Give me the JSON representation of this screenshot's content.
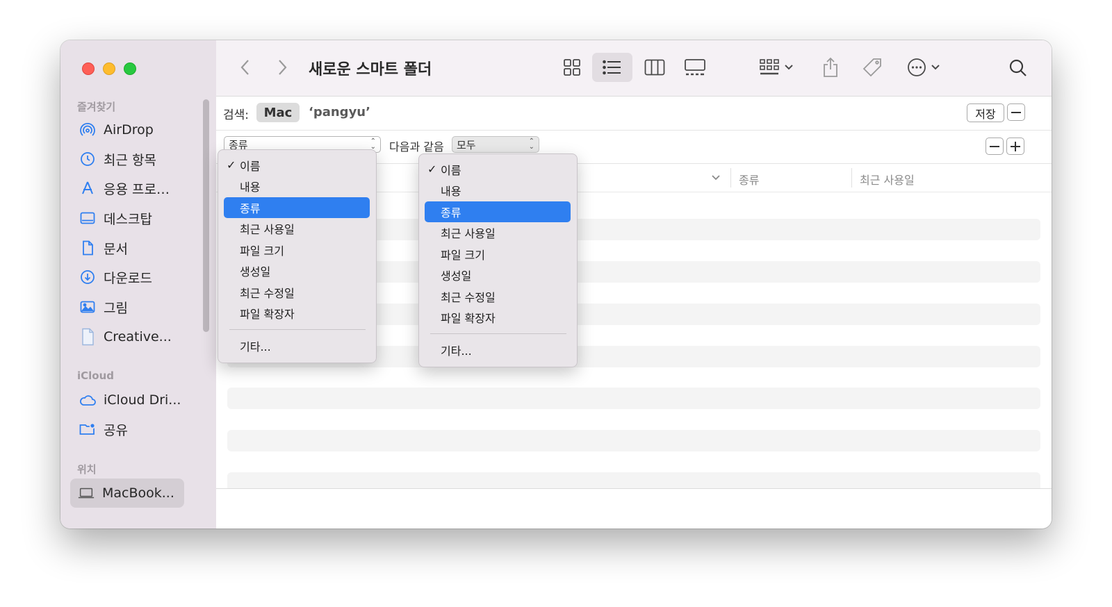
{
  "window": {
    "title": "새로운 스마트 폴더"
  },
  "sidebar": {
    "sections": [
      {
        "label": "즐겨찾기"
      },
      {
        "label": "iCloud"
      },
      {
        "label": "위치"
      }
    ],
    "favorites": [
      {
        "label": "AirDrop",
        "icon": "airdrop-icon"
      },
      {
        "label": "최근 항목",
        "icon": "clock-icon"
      },
      {
        "label": "응용 프로…",
        "icon": "applications-icon"
      },
      {
        "label": "데스크탑",
        "icon": "desktop-icon"
      },
      {
        "label": "문서",
        "icon": "document-icon"
      },
      {
        "label": "다운로드",
        "icon": "download-icon"
      },
      {
        "label": "그림",
        "icon": "pictures-icon"
      },
      {
        "label": "Creative...",
        "icon": "file-icon"
      }
    ],
    "icloud": [
      {
        "label": "iCloud Dri...",
        "icon": "cloud-icon"
      },
      {
        "label": "공유",
        "icon": "shared-folder-icon"
      }
    ],
    "locations": [
      {
        "label": "MacBook...",
        "icon": "laptop-icon",
        "selected": true
      }
    ]
  },
  "search": {
    "label": "검색:",
    "scope": "Mac",
    "term": "‘pangyu’",
    "save_label": "저장"
  },
  "criteria": {
    "attribute": "종류",
    "operator_label": "다음과 같음",
    "value": "모두"
  },
  "columns": [
    {
      "label": "종류"
    },
    {
      "label": "최근 사용일"
    }
  ],
  "menu_left": {
    "checked": "이름",
    "items": [
      "이름",
      "내용",
      "종류",
      "최근 사용일",
      "파일 크기",
      "생성일",
      "최근 수정일",
      "파일 확장자"
    ],
    "highlighted": "종류",
    "other": "기타..."
  },
  "menu_right": {
    "checked": "이름",
    "items": [
      "이름",
      "내용",
      "종류",
      "최근 사용일",
      "파일 크기",
      "생성일",
      "최근 수정일",
      "파일 확장자"
    ],
    "highlighted": "종류",
    "other": "기타..."
  },
  "colors": {
    "accent": "#2f7ff0",
    "sidebar_bg": "#e8e1e8",
    "traffic_red": "#fe5f57",
    "traffic_yellow": "#febc2e",
    "traffic_green": "#28c840",
    "icon_blue": "#2f7ff0"
  }
}
